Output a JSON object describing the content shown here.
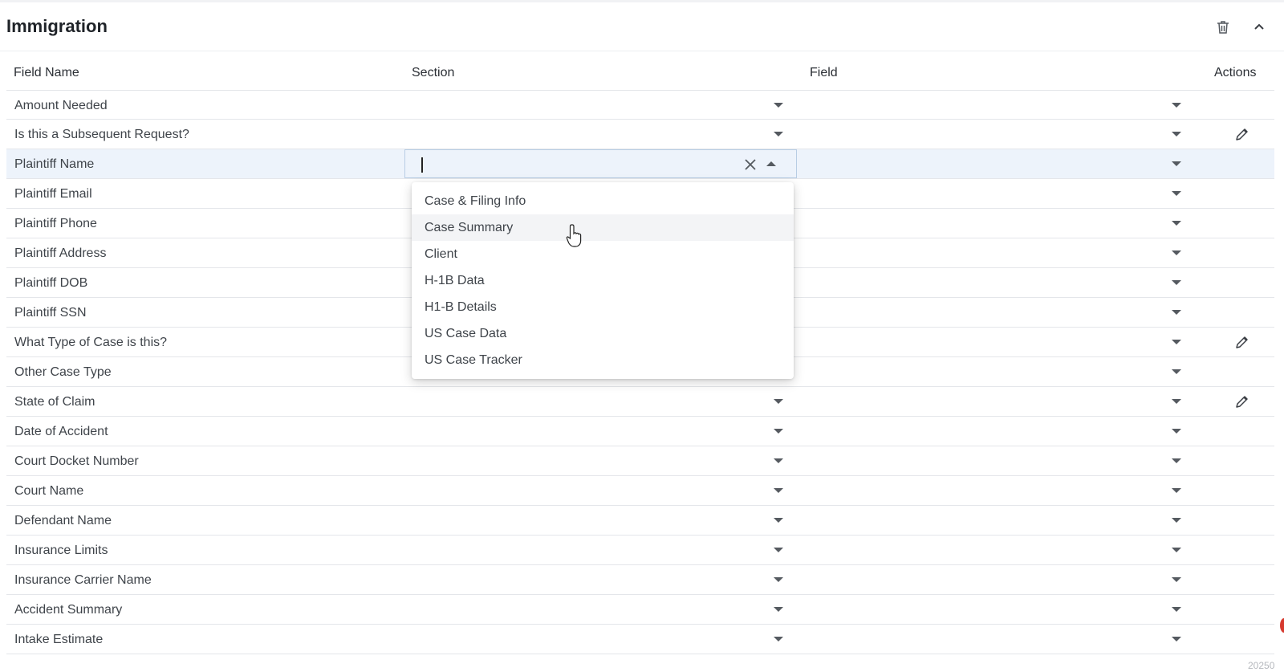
{
  "header": {
    "title": "Immigration"
  },
  "columns": {
    "field_name": "Field Name",
    "section": "Section",
    "field": "Field",
    "actions": "Actions"
  },
  "rows": [
    {
      "name": "Amount Needed",
      "edit": false
    },
    {
      "name": "Is this a Subsequent Request?",
      "edit": true
    },
    {
      "name": "Plaintiff Name",
      "edit": false,
      "active": true
    },
    {
      "name": "Plaintiff Email",
      "edit": false
    },
    {
      "name": "Plaintiff Phone",
      "edit": false
    },
    {
      "name": "Plaintiff Address",
      "edit": false
    },
    {
      "name": "Plaintiff DOB",
      "edit": false
    },
    {
      "name": "Plaintiff SSN",
      "edit": false
    },
    {
      "name": "What Type of Case is this?",
      "edit": true
    },
    {
      "name": "Other Case Type",
      "edit": false
    },
    {
      "name": "State of Claim",
      "edit": true
    },
    {
      "name": "Date of Accident",
      "edit": false
    },
    {
      "name": "Court Docket Number",
      "edit": false
    },
    {
      "name": "Court Name",
      "edit": false
    },
    {
      "name": "Defendant Name",
      "edit": false
    },
    {
      "name": "Insurance Limits",
      "edit": false
    },
    {
      "name": "Insurance Carrier Name",
      "edit": false
    },
    {
      "name": "Accident Summary",
      "edit": false
    },
    {
      "name": "Intake Estimate",
      "edit": false
    }
  ],
  "section_input": {
    "value": ""
  },
  "dropdown": {
    "options": [
      "Case & Filing Info",
      "Case Summary",
      "Client",
      "H-1B Data",
      "H1-B Details",
      "US Case Data",
      "US Case Tracker"
    ],
    "hovered": "Case Summary"
  },
  "watermark": "20250"
}
